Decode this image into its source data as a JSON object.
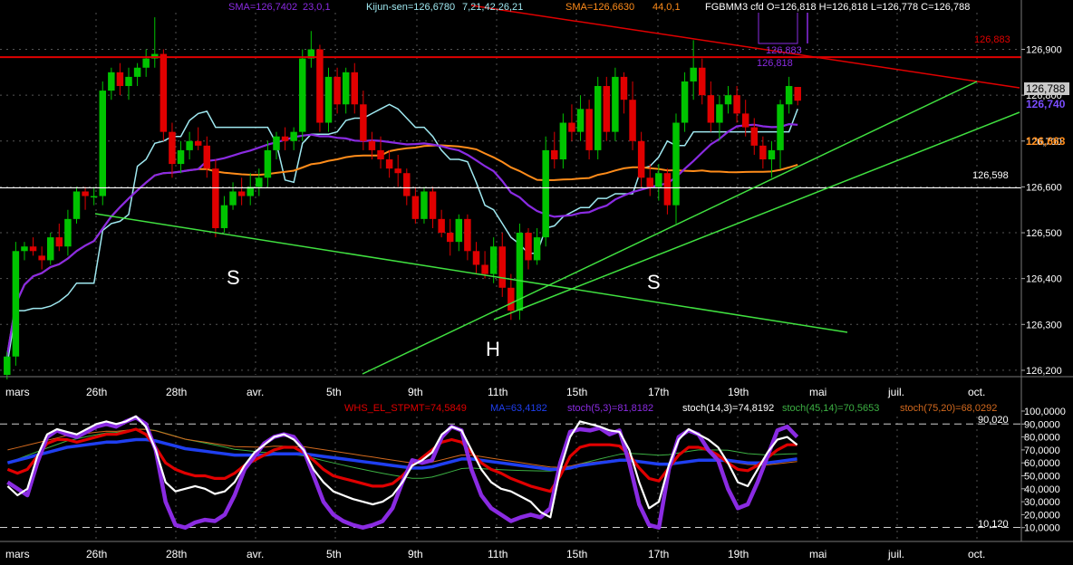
{
  "header": {
    "sma1_label": "SMA=126,7402",
    "sma1_params": "23,0,1",
    "kijun_label": "Kijun-sen=126,6780",
    "kijun_params": "7,21,42,26,21",
    "sma2_label": "SMA=126,6630",
    "sma2_params": "44,0,1",
    "instrument_ohlc": "FGBMM3 cfd O=126,818 H=126,818 L=126,778 C=126,788"
  },
  "colors": {
    "background": "#000000",
    "bull": "#00c400",
    "bear": "#e00000",
    "sma_fast": "#8a2be2",
    "kijun": "#9fe8f0",
    "sma_slow": "#ff8c1a",
    "resistance": "#e00000",
    "trendline": "#40e040",
    "support": "#ffffff",
    "grid": "#555555",
    "stoch_fast": "#8a2be2",
    "stoch_mid": "#ffffff",
    "stoch_red": "#e00000",
    "stoch_blue": "#1f3ff0",
    "stoch_green": "#3cb043",
    "stoch_orange": "#d2691e"
  },
  "price_panel": {
    "y_ticks": [
      "126,900",
      "126,800",
      "126,700",
      "126,600",
      "126,500",
      "126,400",
      "126,300",
      "126,200"
    ],
    "y_tick_values": [
      126.9,
      126.8,
      126.7,
      126.6,
      126.5,
      126.4,
      126.3,
      126.2
    ],
    "ylim": [
      126.19,
      126.98
    ],
    "x_ticks": [
      "mars",
      "26th",
      "28th",
      "avr.",
      "5th",
      "9th",
      "11th",
      "15th",
      "17th",
      "19th",
      "mai",
      "juil.",
      "oct."
    ],
    "resistance_level": 126.883,
    "resistance_label": "126,883",
    "support_level": 126.598,
    "support_label": "126,598",
    "last_close_label": "126,788",
    "sma_fast_label": "126,740",
    "sma_slow_label": "126,663",
    "mini_label_1": "126,883",
    "mini_label_2": "126,818",
    "pattern_labels": [
      "S",
      "H",
      "S"
    ]
  },
  "chart_data": [
    {
      "type": "candlestick",
      "title": "FGBMM3 cfd",
      "candles": [
        [
          126.19,
          126.24,
          126.18,
          126.23
        ],
        [
          126.23,
          126.48,
          126.21,
          126.46
        ],
        [
          126.46,
          126.48,
          126.44,
          126.47
        ],
        [
          126.47,
          126.49,
          126.45,
          126.46
        ],
        [
          126.45,
          126.47,
          126.42,
          126.44
        ],
        [
          126.44,
          126.5,
          126.43,
          126.49
        ],
        [
          126.49,
          126.52,
          126.46,
          126.47
        ],
        [
          126.47,
          126.55,
          126.45,
          126.53
        ],
        [
          126.53,
          126.6,
          126.52,
          126.59
        ],
        [
          126.59,
          126.6,
          126.55,
          126.58
        ],
        [
          126.58,
          126.6,
          126.56,
          126.58
        ],
        [
          126.58,
          126.83,
          126.56,
          126.81
        ],
        [
          126.81,
          126.86,
          126.79,
          126.85
        ],
        [
          126.85,
          126.87,
          126.8,
          126.82
        ],
        [
          126.82,
          126.86,
          126.79,
          126.84
        ],
        [
          126.84,
          126.87,
          126.82,
          126.86
        ],
        [
          126.86,
          126.9,
          126.84,
          126.88
        ],
        [
          126.88,
          126.97,
          126.86,
          126.89
        ],
        [
          126.89,
          126.9,
          126.7,
          126.72
        ],
        [
          126.72,
          126.74,
          126.62,
          126.65
        ],
        [
          126.65,
          126.7,
          126.63,
          126.68
        ],
        [
          126.68,
          126.72,
          126.66,
          126.7
        ],
        [
          126.7,
          126.73,
          126.68,
          126.69
        ],
        [
          126.69,
          126.71,
          126.62,
          126.64
        ],
        [
          126.64,
          126.66,
          126.49,
          126.51
        ],
        [
          126.51,
          126.58,
          126.5,
          126.56
        ],
        [
          126.56,
          126.61,
          126.55,
          126.59
        ],
        [
          126.59,
          126.62,
          126.56,
          126.58
        ],
        [
          126.58,
          126.63,
          126.56,
          126.6
        ],
        [
          126.6,
          126.64,
          126.58,
          126.62
        ],
        [
          126.62,
          126.7,
          126.6,
          126.68
        ],
        [
          126.68,
          126.72,
          126.66,
          126.71
        ],
        [
          126.71,
          126.73,
          126.68,
          126.7
        ],
        [
          126.7,
          126.73,
          126.68,
          126.72
        ],
        [
          126.72,
          126.9,
          126.7,
          126.88
        ],
        [
          126.88,
          126.94,
          126.86,
          126.9
        ],
        [
          126.9,
          126.91,
          126.72,
          126.74
        ],
        [
          126.74,
          126.86,
          126.72,
          126.84
        ],
        [
          126.84,
          126.86,
          126.76,
          126.78
        ],
        [
          126.78,
          126.86,
          126.76,
          126.85
        ],
        [
          126.85,
          126.87,
          126.76,
          126.78
        ],
        [
          126.78,
          126.81,
          126.68,
          126.7
        ],
        [
          126.7,
          126.72,
          126.66,
          126.68
        ],
        [
          126.68,
          126.71,
          126.64,
          126.66
        ],
        [
          126.66,
          126.68,
          126.62,
          126.64
        ],
        [
          126.64,
          126.67,
          126.6,
          126.63
        ],
        [
          126.63,
          126.64,
          126.56,
          126.58
        ],
        [
          126.58,
          126.6,
          126.52,
          126.53
        ],
        [
          126.53,
          126.6,
          126.52,
          126.59
        ],
        [
          126.59,
          126.6,
          126.51,
          126.53
        ],
        [
          126.53,
          126.55,
          126.49,
          126.5
        ],
        [
          126.5,
          126.53,
          126.45,
          126.48
        ],
        [
          126.48,
          126.54,
          126.46,
          126.53
        ],
        [
          126.53,
          126.54,
          126.44,
          126.46
        ],
        [
          126.46,
          126.48,
          126.41,
          126.43
        ],
        [
          126.43,
          126.46,
          126.4,
          126.41
        ],
        [
          126.41,
          126.49,
          126.39,
          126.47
        ],
        [
          126.47,
          126.5,
          126.36,
          126.38
        ],
        [
          126.38,
          126.41,
          126.31,
          126.33
        ],
        [
          126.33,
          126.52,
          126.31,
          126.5
        ],
        [
          126.5,
          126.51,
          126.42,
          126.44
        ],
        [
          126.44,
          126.51,
          126.43,
          126.49
        ],
        [
          126.49,
          126.71,
          126.47,
          126.68
        ],
        [
          126.68,
          126.72,
          126.64,
          126.66
        ],
        [
          126.66,
          126.76,
          126.64,
          126.74
        ],
        [
          126.74,
          126.78,
          126.7,
          126.72
        ],
        [
          126.72,
          126.8,
          126.7,
          126.77
        ],
        [
          126.77,
          126.79,
          126.66,
          126.68
        ],
        [
          126.68,
          126.84,
          126.66,
          126.82
        ],
        [
          126.82,
          126.84,
          126.7,
          126.72
        ],
        [
          126.72,
          126.86,
          126.7,
          126.84
        ],
        [
          126.84,
          126.85,
          126.76,
          126.79
        ],
        [
          126.79,
          126.83,
          126.68,
          126.7
        ],
        [
          126.7,
          126.72,
          126.6,
          126.62
        ],
        [
          126.62,
          126.65,
          126.58,
          126.6
        ],
        [
          126.6,
          126.65,
          126.57,
          126.63
        ],
        [
          126.63,
          126.64,
          126.54,
          126.56
        ],
        [
          126.56,
          126.76,
          126.52,
          126.74
        ],
        [
          126.74,
          126.85,
          126.72,
          126.83
        ],
        [
          126.83,
          126.92,
          126.79,
          126.86
        ],
        [
          126.86,
          126.88,
          126.78,
          126.8
        ],
        [
          126.8,
          126.83,
          126.72,
          126.74
        ],
        [
          126.74,
          126.8,
          126.7,
          126.78
        ],
        [
          126.78,
          126.82,
          126.76,
          126.8
        ],
        [
          126.8,
          126.82,
          126.74,
          126.76
        ],
        [
          126.76,
          126.79,
          126.71,
          126.73
        ],
        [
          126.73,
          126.75,
          126.67,
          126.69
        ],
        [
          126.69,
          126.71,
          126.64,
          126.66
        ],
        [
          126.66,
          126.7,
          126.62,
          126.68
        ],
        [
          126.68,
          126.79,
          126.64,
          126.78
        ],
        [
          126.78,
          126.84,
          126.76,
          126.82
        ],
        [
          126.818,
          126.818,
          126.778,
          126.788
        ]
      ]
    },
    {
      "type": "line",
      "title": "Stochastic oscillators",
      "ylim": [
        0,
        100
      ],
      "y_ticks": [
        "100,0000",
        "90,0000",
        "80,0000",
        "70,0000",
        "60,0000",
        "50,0000",
        "40,0000",
        "30,0000",
        "20,0000",
        "10,0000"
      ],
      "y_tick_values": [
        100,
        90,
        80,
        70,
        60,
        50,
        40,
        30,
        20,
        10
      ],
      "upper_level": 90.02,
      "upper_level_label": "90,020",
      "lower_level": 10.12,
      "lower_level_label": "10,120",
      "legend": [
        "WHS_EL_STPMT=74,5849",
        "MA=63,4182",
        "stoch(5,3)=81,8182",
        "stoch(14,3)=74,8192",
        "stoch(45,14)=70,5653",
        "stoch(75,20)=68,0292"
      ],
      "series": [
        {
          "name": "stoch(5,3)",
          "values": [
            45,
            40,
            35,
            60,
            80,
            85,
            82,
            80,
            84,
            88,
            90,
            88,
            92,
            95,
            90,
            70,
            30,
            12,
            10,
            14,
            16,
            15,
            20,
            35,
            55,
            65,
            75,
            80,
            82,
            80,
            70,
            50,
            30,
            20,
            15,
            12,
            10,
            12,
            15,
            25,
            45,
            62,
            60,
            62,
            80,
            88,
            85,
            55,
            35,
            25,
            20,
            15,
            18,
            20,
            18,
            25,
            60,
            84,
            86,
            85,
            87,
            82,
            85,
            60,
            28,
            12,
            10,
            55,
            80,
            85,
            82,
            70,
            62,
            40,
            25,
            28,
            45,
            65,
            85,
            88,
            80
          ]
        },
        {
          "name": "stoch(14,3)",
          "values": [
            42,
            35,
            40,
            65,
            82,
            86,
            84,
            82,
            86,
            90,
            92,
            90,
            92,
            96,
            88,
            70,
            45,
            38,
            40,
            42,
            40,
            36,
            38,
            45,
            58,
            68,
            74,
            80,
            82,
            78,
            70,
            55,
            45,
            38,
            35,
            32,
            30,
            28,
            30,
            35,
            45,
            58,
            62,
            68,
            82,
            88,
            85,
            70,
            55,
            45,
            40,
            38,
            34,
            30,
            22,
            18,
            55,
            80,
            92,
            90,
            88,
            85,
            84,
            70,
            45,
            25,
            30,
            58,
            78,
            86,
            82,
            78,
            72,
            60,
            45,
            42,
            55,
            68,
            78,
            80,
            74
          ]
        },
        {
          "name": "WHS_EL_STPMT",
          "values": [
            55,
            52,
            55,
            65,
            75,
            78,
            78,
            76,
            78,
            80,
            82,
            82,
            84,
            86,
            82,
            72,
            60,
            55,
            52,
            50,
            50,
            48,
            48,
            52,
            58,
            62,
            66,
            70,
            72,
            72,
            68,
            62,
            55,
            50,
            48,
            46,
            44,
            42,
            42,
            44,
            50,
            58,
            64,
            70,
            76,
            78,
            76,
            68,
            60,
            55,
            52,
            48,
            45,
            42,
            40,
            38,
            50,
            65,
            72,
            74,
            74,
            74,
            73,
            66,
            56,
            48,
            46,
            56,
            66,
            72,
            72,
            70,
            66,
            60,
            55,
            54,
            58,
            64,
            70,
            74,
            74
          ]
        },
        {
          "name": "MA",
          "values": [
            60,
            62,
            64,
            66,
            68,
            70,
            72,
            73,
            74,
            75,
            76,
            76,
            77,
            78,
            78,
            77,
            75,
            73,
            71,
            70,
            69,
            68,
            67,
            66,
            66,
            66,
            66,
            67,
            67,
            67,
            67,
            66,
            65,
            64,
            63,
            62,
            61,
            60,
            59,
            58,
            57,
            56,
            56,
            57,
            59,
            61,
            63,
            63,
            62,
            61,
            60,
            59,
            58,
            57,
            56,
            55,
            55,
            56,
            58,
            59,
            60,
            61,
            62,
            62,
            61,
            60,
            59,
            59,
            60,
            61,
            62,
            62,
            62,
            62,
            61,
            60,
            60,
            60,
            61,
            62,
            63
          ]
        }
      ]
    }
  ]
}
